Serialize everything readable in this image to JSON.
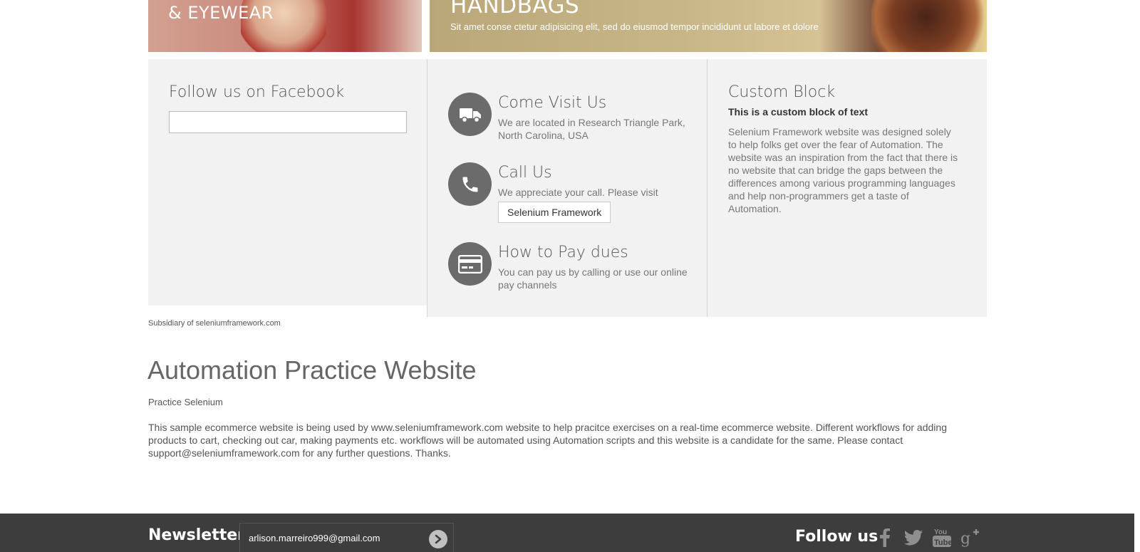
{
  "banners": {
    "left_title": "& EYEWEAR",
    "right_title": "HANDBAGS",
    "right_text": "Sit amet conse ctetur adipisicing elit, sed do eiusmod tempor incididunt ut labore et dolore"
  },
  "facebook": {
    "heading": "Follow us on Facebook"
  },
  "contact": {
    "items": [
      {
        "icon": "truck-icon",
        "title": "Come Visit Us",
        "desc": "We are located in Research Triangle Park, North Carolina, USA"
      },
      {
        "icon": "phone-icon",
        "title": "Call Us",
        "desc": "We appreciate your call. Please visit",
        "button": "Selenium Framework"
      },
      {
        "icon": "credit-card-icon",
        "title": "How to Pay dues",
        "desc": "You can pay us by calling or use our online pay channels"
      }
    ]
  },
  "custom_block": {
    "heading": "Custom Block",
    "subheading": "This is a custom block of text",
    "text": "Selenium Framework website was designed solely to help folks get over the fear of Automation. The website was an inspiration from the fact that there is no website that can bridge the gaps between the differences among various programming languages and help non-programmers get a taste of Automation."
  },
  "subsidiary": "Subsidiary of seleniumframework.com",
  "main": {
    "title": "Automation Practice Website",
    "subtitle": "Practice Selenium",
    "description": "This sample ecommerce website is being used by www.seleniumframework.com website to help pracitce exercises on a real-time ecommerce website. Different workflows for adding products to cart, checking out car, making payments etc. workflows will be automated using Automation scripts and this website is a candidate for the same. Please contact support@seleniumframework.com for any further questions. Thanks."
  },
  "footer": {
    "newsletter_label": "Newsletter",
    "newsletter_value": "arlison.marreiro999@gmail.com",
    "follow_label": "Follow us",
    "social": [
      "facebook-icon",
      "twitter-icon",
      "youtube-icon",
      "google-plus-icon"
    ]
  },
  "colors": {
    "footer_bg": "#3d3d3d",
    "panel_bg": "#f2f2f2",
    "icon_circle": "#6b6b6b"
  }
}
